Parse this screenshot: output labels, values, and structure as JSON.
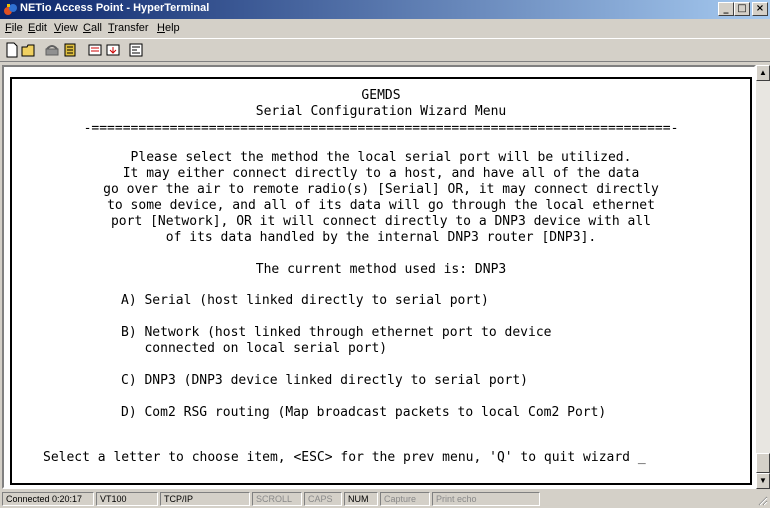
{
  "window": {
    "title": "NETio Access Point - HyperTerminal",
    "controls": [
      "_",
      "□",
      "×"
    ]
  },
  "menu": [
    "File",
    "Edit",
    "View",
    "Call",
    "Transfer",
    "Help"
  ],
  "terminal": {
    "header": "GEMDS",
    "subheader": "Serial Configuration Wizard Menu",
    "separator": "-==========================================================================-",
    "intro": [
      "Please select the method the local serial port will be utilized.",
      "It may either connect directly to a host, and have all of the data",
      "go over the air to remote radio(s) [Serial] OR, it may connect directly",
      "to some device, and all of its data will go through the local ethernet",
      "port [Network], OR it will connect directly to a DNP3 device with all",
      "of its data handled by the internal DNP3 router [DNP3]."
    ],
    "current_method": "The current method used is: DNP3",
    "options": [
      "A) Serial (host linked directly to serial port)",
      "B) Network (host linked through ethernet port to device",
      "   connected on local serial port)",
      "C) DNP3 (DNP3 device linked directly to serial port)",
      "D) Com2 RSG routing (Map broadcast packets to local Com2 Port)"
    ],
    "prompt": "Select a letter to choose item, <ESC> for the prev menu, 'Q' to quit wizard _"
  },
  "status": [
    "Connected 0:20:17",
    "VT100",
    "TCP/IP",
    "SCROLL",
    "CAPS",
    "NUM",
    "Capture",
    "Print echo"
  ],
  "colors": {
    "titlebar_start": "#0a246a",
    "titlebar_end": "#a6caf0",
    "chrome": "#d4d0c8",
    "terminal_bg": "#ffffff"
  }
}
